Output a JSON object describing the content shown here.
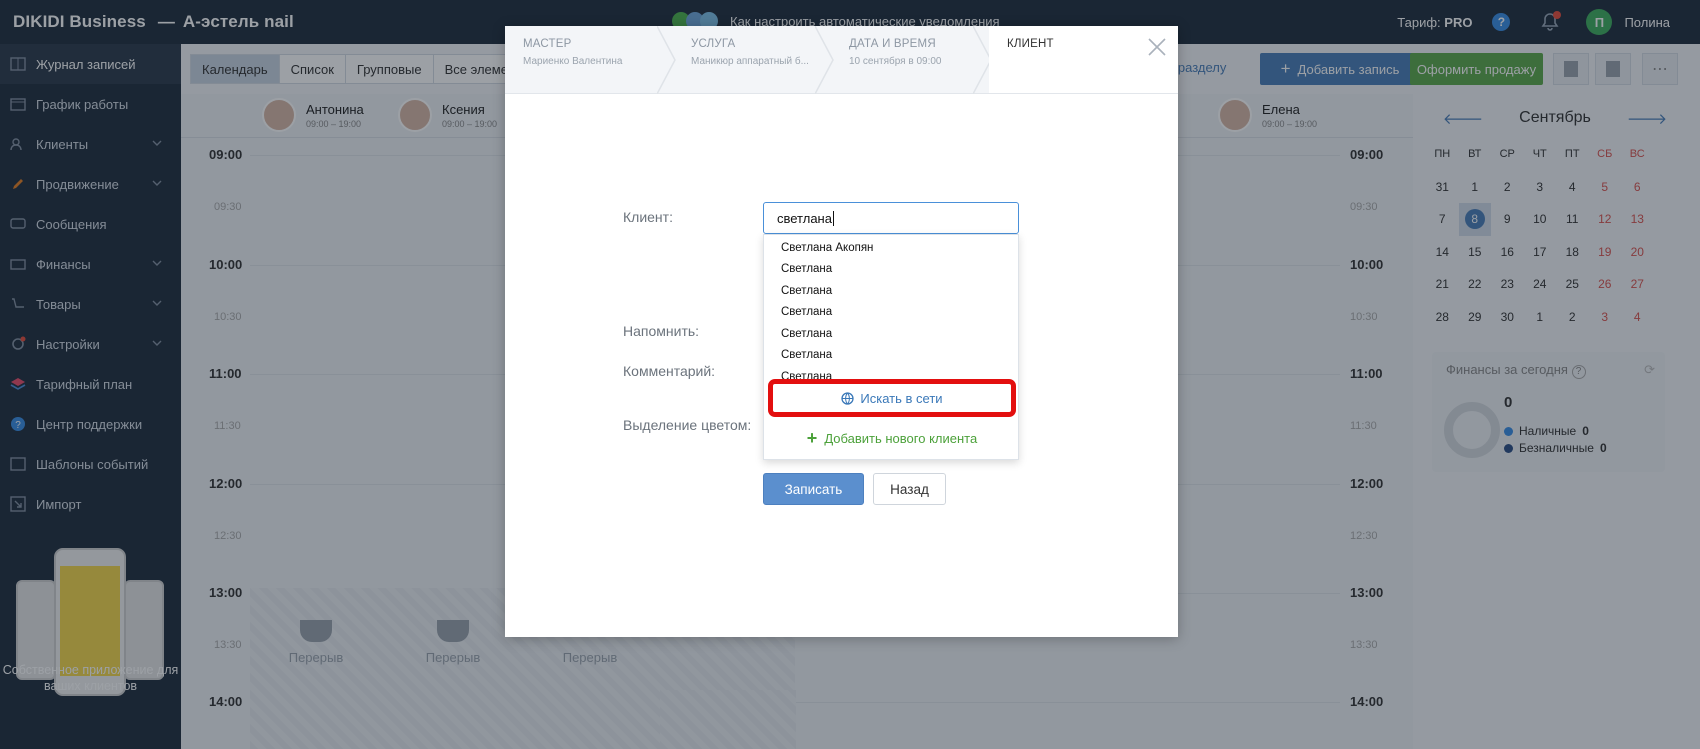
{
  "topbar": {
    "brand": "DIKIDI Business",
    "salon": "А-эстель nail",
    "promo_text": "Как настроить автоматические уведомления",
    "tariff_label": "Тариф:",
    "tariff_value": "PRO",
    "help": "?",
    "avatar_letter": "П",
    "username": "Полина"
  },
  "sidebar": {
    "items": [
      {
        "label": "Журнал записей",
        "icon": "journal-icon"
      },
      {
        "label": "График работы",
        "icon": "calendar-icon"
      },
      {
        "label": "Клиенты",
        "icon": "clients-icon"
      },
      {
        "label": "Продвижение",
        "icon": "rocket-icon"
      },
      {
        "label": "Сообщения",
        "icon": "messages-icon"
      },
      {
        "label": "Финансы",
        "icon": "finance-icon"
      },
      {
        "label": "Товары",
        "icon": "goods-icon"
      },
      {
        "label": "Настройки",
        "icon": "settings-icon"
      },
      {
        "label": "Тарифный план",
        "icon": "layers-icon"
      },
      {
        "label": "Центр поддержки",
        "icon": "help-icon"
      },
      {
        "label": "Шаблоны событий",
        "icon": "templates-icon"
      },
      {
        "label": "Импорт",
        "icon": "import-icon"
      }
    ],
    "promo_text": "Собственное приложение для ваших клиентов"
  },
  "toolbar": {
    "views": [
      "Календарь",
      "Список",
      "Групповые",
      "Все элемен"
    ],
    "by_section": "по разделу",
    "add_record": "Добавить запись",
    "make_sale": "Оформить продажу"
  },
  "staff": [
    {
      "name": "Антонина",
      "hours": "09:00 – 19:00"
    },
    {
      "name": "Ксения",
      "hours": "09:00 – 19:00"
    },
    {
      "name": "Елена",
      "hours": "09:00 – 19:00"
    }
  ],
  "times": [
    "09:00",
    "09:30",
    "10:00",
    "10:30",
    "11:00",
    "11:30",
    "12:00",
    "12:30",
    "13:00",
    "13:30",
    "14:00"
  ],
  "break_label": "Перерыв",
  "minical": {
    "month": "Сентябрь",
    "weekdays": [
      "ПН",
      "ВТ",
      "СР",
      "ЧТ",
      "ПТ",
      "СБ",
      "ВС"
    ],
    "weeks": [
      [
        "31",
        "1",
        "2",
        "3",
        "4",
        "5",
        "6"
      ],
      [
        "7",
        "8",
        "9",
        "10",
        "11",
        "12",
        "13"
      ],
      [
        "14",
        "15",
        "16",
        "17",
        "18",
        "19",
        "20"
      ],
      [
        "21",
        "22",
        "23",
        "24",
        "25",
        "26",
        "27"
      ],
      [
        "28",
        "29",
        "30",
        "1",
        "2",
        "3",
        "4"
      ]
    ],
    "today": "8"
  },
  "finance": {
    "title": "Финансы за сегодня",
    "total": "0",
    "cash_label": "Наличные",
    "cash_value": "0",
    "noncash_label": "Безналичные",
    "noncash_value": "0",
    "cash_color": "#3a8ee6",
    "noncash_color": "#2c4f86"
  },
  "modal": {
    "steps": [
      {
        "title": "МАСТЕР",
        "sub": "Мариенко Валентина"
      },
      {
        "title": "УСЛУГА",
        "sub": "Маникюр аппаратный б..."
      },
      {
        "title": "ДАТА И ВРЕМЯ",
        "sub": "10 сентября в 09:00"
      },
      {
        "title": "КЛИЕНТ",
        "sub": ""
      }
    ],
    "labels": {
      "client": "Клиент:",
      "remind": "Напомнить:",
      "comment": "Комментарий:",
      "color": "Выделение цветом:"
    },
    "client_value": "светлана",
    "suggestions": [
      "Светлана Акопян",
      "Светлана",
      "Светлана",
      "Светлана",
      "Светлана",
      "Светлана",
      "Светлана"
    ],
    "search_online": "Искать в сети",
    "add_new_client": "Добавить нового клиента",
    "save": "Записать",
    "back": "Назад",
    "highlight_color": "#e30f0f"
  }
}
